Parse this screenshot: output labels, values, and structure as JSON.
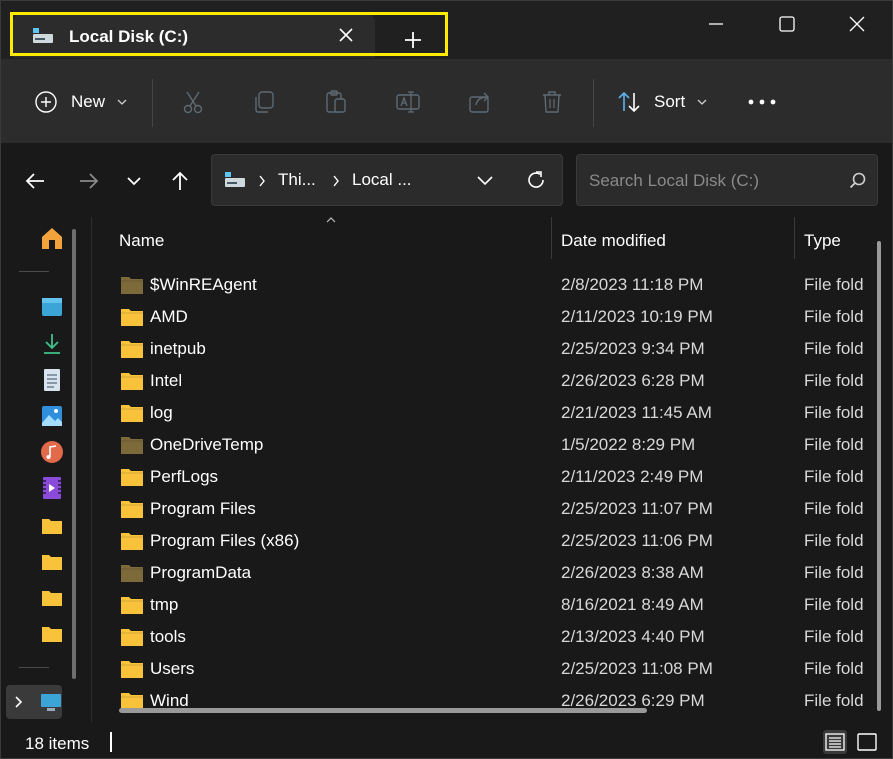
{
  "tab": {
    "title": "Local Disk (C:)"
  },
  "toolbar": {
    "new_label": "New",
    "sort_label": "Sort"
  },
  "address": {
    "crumb1": "Thi...",
    "crumb2": "Local ..."
  },
  "search": {
    "placeholder": "Search Local Disk (C:)"
  },
  "columns": {
    "name": "Name",
    "date": "Date modified",
    "type": "Type"
  },
  "files": [
    {
      "name": "$WinREAgent",
      "date": "2/8/2023 11:18 PM",
      "type": "File fold",
      "hidden": true
    },
    {
      "name": "AMD",
      "date": "2/11/2023 10:19 PM",
      "type": "File fold",
      "hidden": false
    },
    {
      "name": "inetpub",
      "date": "2/25/2023 9:34 PM",
      "type": "File fold",
      "hidden": false
    },
    {
      "name": "Intel",
      "date": "2/26/2023 6:28 PM",
      "type": "File fold",
      "hidden": false
    },
    {
      "name": "log",
      "date": "2/21/2023 11:45 AM",
      "type": "File fold",
      "hidden": false
    },
    {
      "name": "OneDriveTemp",
      "date": "1/5/2022 8:29 PM",
      "type": "File fold",
      "hidden": true
    },
    {
      "name": "PerfLogs",
      "date": "2/11/2023 2:49 PM",
      "type": "File fold",
      "hidden": false
    },
    {
      "name": "Program Files",
      "date": "2/25/2023 11:07 PM",
      "type": "File fold",
      "hidden": false
    },
    {
      "name": "Program Files (x86)",
      "date": "2/25/2023 11:06 PM",
      "type": "File fold",
      "hidden": false
    },
    {
      "name": "ProgramData",
      "date": "2/26/2023 8:38 AM",
      "type": "File fold",
      "hidden": true
    },
    {
      "name": "tmp",
      "date": "8/16/2021 8:49 AM",
      "type": "File fold",
      "hidden": false
    },
    {
      "name": "tools",
      "date": "2/13/2023 4:40 PM",
      "type": "File fold",
      "hidden": false
    },
    {
      "name": "Users",
      "date": "2/25/2023 11:08 PM",
      "type": "File fold",
      "hidden": false
    },
    {
      "name": "Wind",
      "date": "2/26/2023 6:29 PM",
      "type": "File fold",
      "hidden": false
    }
  ],
  "status": {
    "item_count": "18 items"
  },
  "colors": {
    "highlight": "#ffeb00",
    "folder": "#f8c23a",
    "folder_hidden": "#7d6a3a"
  }
}
